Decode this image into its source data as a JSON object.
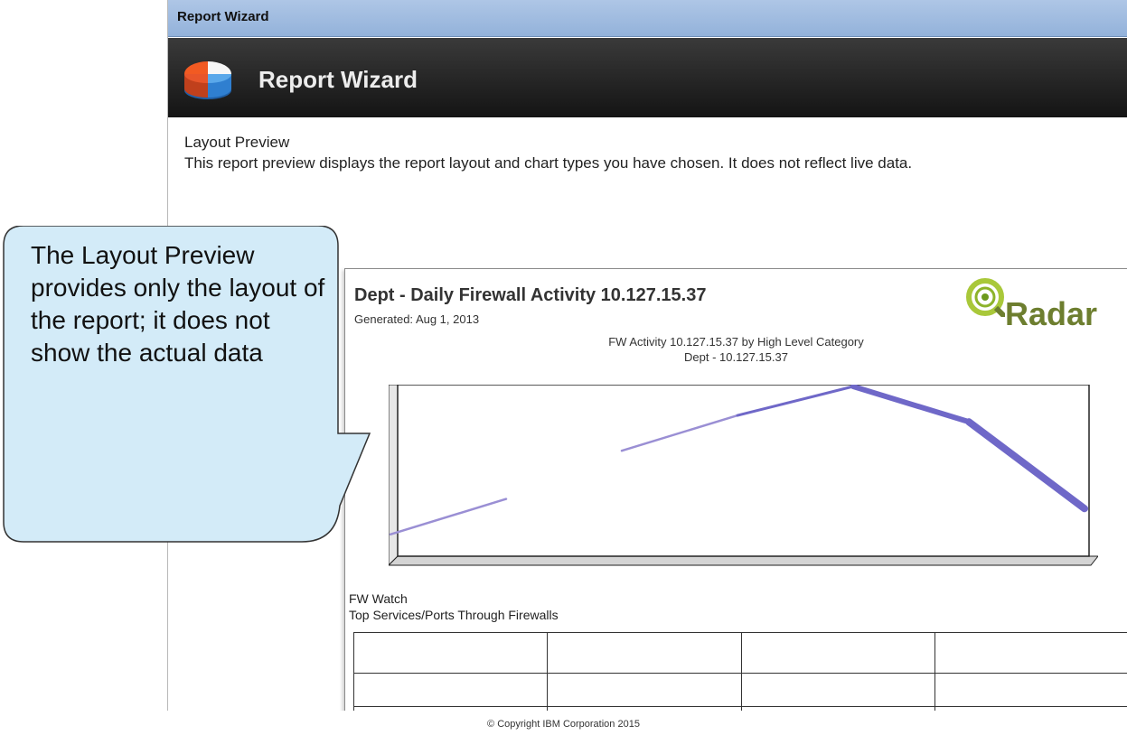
{
  "window": {
    "title": "Report Wizard"
  },
  "header": {
    "title": "Report Wizard",
    "icon": "pie-chart-icon"
  },
  "intro": {
    "heading": "Layout Preview",
    "description": "This report preview displays the report layout and chart types you have chosen. It does not reflect live data."
  },
  "report": {
    "title": "Dept - Daily Firewall Activity 10.127.15.37",
    "generated": "Generated: Aug 1, 2013",
    "logo_text": "Radar",
    "chart_title": "FW Activity 10.127.15.37 by High Level Category",
    "chart_subtitle": "Dept - 10.127.15.37",
    "section_1": "FW Watch",
    "section_2": "Top Services/Ports Through Firewalls",
    "table": {
      "columns": 4,
      "visible_rows": 3
    }
  },
  "chart_data": {
    "type": "line",
    "title": "FW Activity 10.127.15.37 by High Level Category",
    "subtitle": "Dept - 10.127.15.37",
    "x": [
      0,
      1,
      2,
      3,
      4,
      5,
      6
    ],
    "values": [
      0.08,
      0.3,
      0.6,
      0.82,
      1.0,
      0.78,
      0.24
    ],
    "ylim": [
      0,
      1
    ],
    "grid": false,
    "legend": "none",
    "line_color": "#9a8fd4",
    "note_style": "placeholder line segments, thicker toward the end"
  },
  "callout": {
    "text": "The Layout Preview provides only the layout of the report; it does not show the actual data"
  },
  "footer": {
    "copyright": "© Copyright IBM Corporation 2015"
  },
  "colors": {
    "titlebar": "#9fbbe0",
    "header": "#1e1e1e",
    "callout_fill": "#cfe9f7",
    "logo_green": "#6d7e2f"
  }
}
